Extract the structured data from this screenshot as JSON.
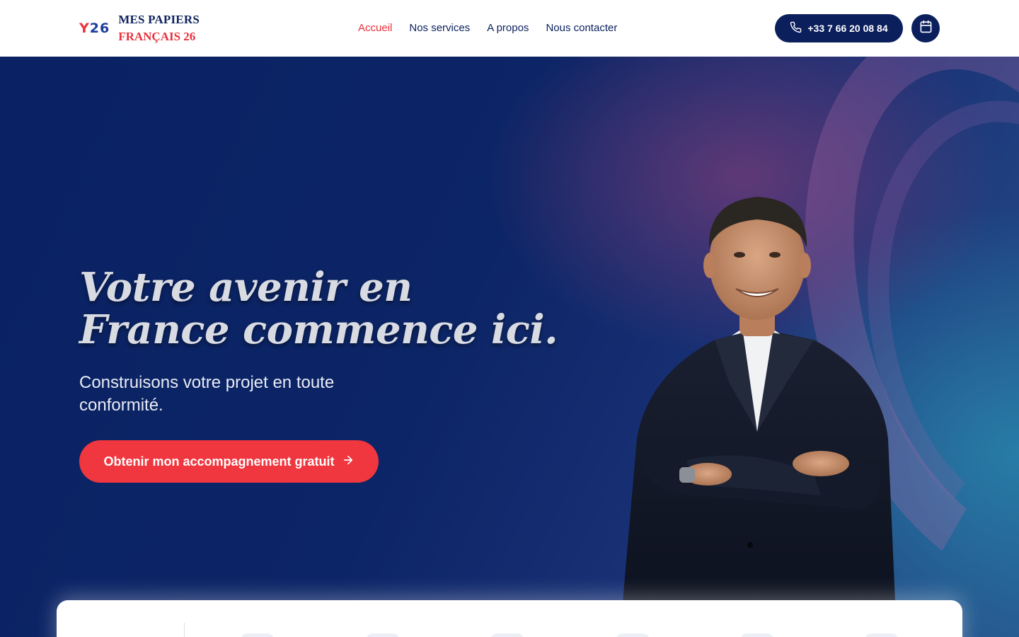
{
  "logo": {
    "mark_y": "Y",
    "mark_num": "26",
    "line1": "MES PAPIERS",
    "line2": "FRANÇAIS 26"
  },
  "nav": {
    "items": [
      {
        "label": "Accueil",
        "active": true
      },
      {
        "label": "Nos services",
        "active": false
      },
      {
        "label": "A propos",
        "active": false
      },
      {
        "label": "Nous contacter",
        "active": false
      }
    ]
  },
  "header_actions": {
    "phone_label": "+33 7 66 20 08 84",
    "phone_icon": "phone-icon",
    "calendar_icon": "calendar-icon"
  },
  "hero": {
    "headline_line1": "Votre avenir en",
    "headline_line2": "France commence ici.",
    "subline": "Construisons votre projet en toute conformité.",
    "cta_label": "Obtenir mon accompagnement gratuit",
    "cta_icon": "arrow-right-icon"
  },
  "colors": {
    "brand_navy": "#0b1f5c",
    "brand_red": "#f0363e",
    "hero_bg": "#0a2263"
  }
}
